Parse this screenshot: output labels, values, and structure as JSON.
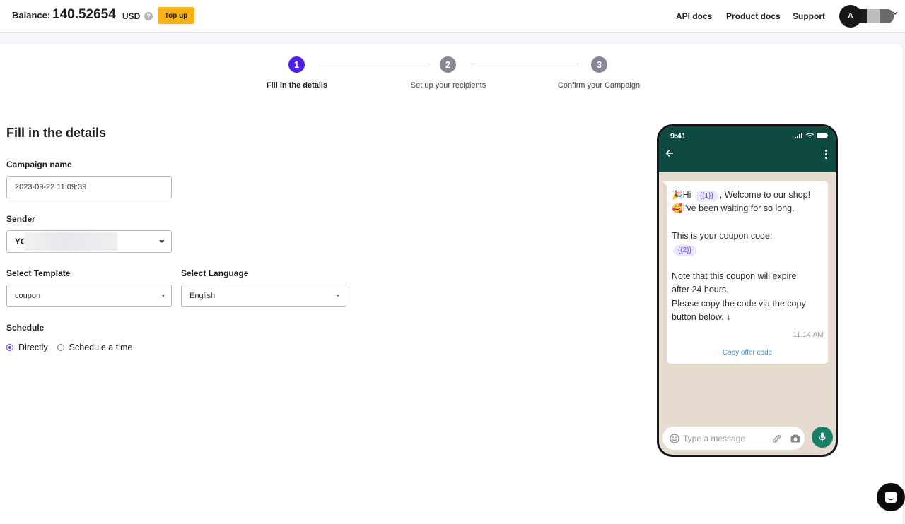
{
  "header": {
    "balance_label": "Balance:",
    "balance_value": "140.52654",
    "currency": "USD",
    "help_icon": "?",
    "topup_label": "Top up",
    "nav": [
      "API docs",
      "Product docs",
      "Support"
    ],
    "avatar_initial": "A",
    "chevron": "⌄"
  },
  "stepper": {
    "steps": [
      {
        "number": "1",
        "label": "Fill in the details",
        "active": true
      },
      {
        "number": "2",
        "label": "Set up your recipients",
        "active": false
      },
      {
        "number": "3",
        "label": "Confirm your Campaign",
        "active": false
      }
    ],
    "active_color": "#4f1ee8",
    "inactive_color": "#8a8595"
  },
  "form": {
    "title": "Fill in the details",
    "campaign_name_label": "Campaign name",
    "campaign_name_value": "2023-09-22 11:09:39",
    "sender_label": "Sender",
    "sender_value": "YC",
    "template_label": "Select Template",
    "template_value": "coupon",
    "language_label": "Select Language",
    "language_value": "English",
    "schedule_label": "Schedule",
    "schedule_options": [
      {
        "label": "Directly",
        "checked": true
      },
      {
        "label": "Schedule a time",
        "checked": false
      }
    ]
  },
  "phone": {
    "time": "9:41",
    "message": {
      "line1_prefix": "🎉Hi",
      "var1": "{{1}}",
      "line1_suffix": ", Welcome to our shop!",
      "line2": "🥰I've been waiting for so long.",
      "line3": "This is your coupon code:",
      "var2": "{{2}}",
      "line4": "Note that this coupon will expire",
      "line5": "after 24 hours.",
      "line6": "Please copy the code via the copy",
      "line7": "button below. ↓",
      "timestamp": "11.14 AM",
      "button_label": "Copy offer code"
    },
    "input_placeholder": "Type a message"
  },
  "colors": {
    "accent": "#4f1ee8",
    "topup": "#fbb116",
    "whatsapp_header": "#0f4a41",
    "whatsapp_bg": "#e5dccf",
    "mic": "#1a7e69"
  }
}
